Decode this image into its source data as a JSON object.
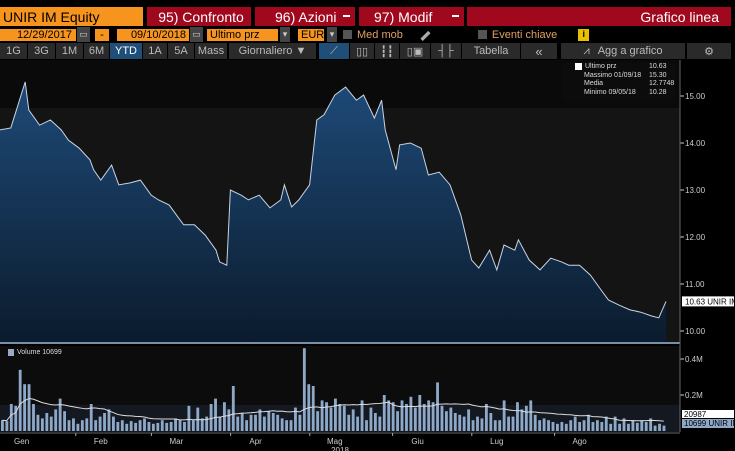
{
  "header": {
    "ticker": "UNIR IM Equity",
    "compare": "95) Confronto",
    "actions": "96) Azioni",
    "edit": "97) Modif",
    "chart_type": "Grafico linea"
  },
  "controls": {
    "start_date": "12/29/2017",
    "dash": "-",
    "end_date": "09/10/2018",
    "field": "Ultimo prz",
    "currency": "EUR",
    "moving_avg": "Med mob",
    "key_events": "Eventi chiave",
    "info": "i"
  },
  "toolbar": {
    "periods": [
      "1G",
      "3G",
      "1M",
      "6M",
      "YTD",
      "1A",
      "5A",
      "Mass"
    ],
    "selected": "YTD",
    "frequency": "Giornaliero ▼",
    "table": "Tabella",
    "collapse": "«",
    "add_chart": "Agg a grafico",
    "settings": "⚙"
  },
  "legend": {
    "last_label": "Ultimo prz",
    "last_value": "10.63",
    "max_label": "Massimo 01/09/18",
    "max_value": "15.30",
    "avg_label": "Media",
    "avg_value": "12.7748",
    "min_label": "Minimo 09/05/18",
    "min_value": "10.28"
  },
  "volume_legend": "Volume 10699",
  "colors": {
    "orange": "#f7941d",
    "red": "#a0081e",
    "line": "#c8d4e4",
    "fill": "#1c3a5e",
    "volume": "#8ea8c8"
  },
  "chart_data": [
    {
      "type": "area",
      "title": "UNIR IM Ultimo prz",
      "ylim": [
        9.7,
        15.75
      ],
      "yticks": [
        "15.00",
        "14.00",
        "13.00",
        "12.00",
        "11.00",
        "10.00"
      ],
      "ytick_values": [
        15,
        14,
        13,
        12,
        11,
        10
      ],
      "last_label": "10.63 UNIR IM",
      "x": [
        0,
        3,
        5,
        7,
        8,
        11,
        14,
        17,
        19,
        22,
        25,
        26,
        28,
        31,
        33,
        36,
        39,
        42,
        44,
        47,
        49,
        51,
        54,
        57,
        60,
        61,
        63,
        64,
        67,
        69,
        72,
        75,
        78,
        79,
        81,
        83,
        86,
        88,
        90,
        93,
        96,
        99,
        101,
        104,
        106,
        107,
        110,
        111,
        114,
        117,
        119,
        122,
        125,
        128,
        131,
        133,
        136,
        138,
        140,
        143,
        144,
        147,
        150,
        153,
        156,
        158,
        161,
        164,
        167,
        169,
        172,
        175,
        178,
        181,
        183,
        185
      ],
      "y": [
        14.28,
        14.32,
        14.81,
        15.3,
        14.7,
        14.38,
        14.49,
        14.28,
        14.06,
        13.89,
        13.64,
        13.43,
        13.21,
        13.53,
        13.11,
        13.15,
        13.21,
        12.89,
        12.79,
        12.68,
        12.47,
        12.26,
        12.26,
        12.04,
        11.72,
        11.47,
        11.4,
        13.0,
        12.89,
        12.79,
        12.89,
        12.62,
        12.79,
        13.11,
        12.64,
        12.79,
        13.11,
        14.49,
        14.6,
        15.02,
        15.19,
        14.91,
        15.02,
        14.53,
        14.91,
        14.28,
        13.43,
        13.96,
        14.0,
        13.89,
        13.32,
        13.38,
        13.11,
        12.47,
        11.51,
        11.34,
        11.72,
        11.3,
        11.83,
        11.72,
        11.94,
        11.51,
        11.3,
        11.55,
        11.47,
        11.4,
        11.4,
        11.19,
        10.87,
        10.66,
        10.55,
        10.45,
        10.4,
        10.32,
        10.28,
        10.63
      ]
    },
    {
      "type": "bar",
      "title": "Volume",
      "ylim": [
        0,
        0.5
      ],
      "yticks": [
        "0.4M",
        "0.2M"
      ],
      "ytick_values": [
        0.4,
        0.2
      ],
      "ma_label": "20987",
      "last_label": "10699 UNIR IM",
      "xlabel": "2018",
      "months": [
        "Gen",
        "Feb",
        "Mar",
        "Apr",
        "Mag",
        "Giu",
        "Lug",
        "Ago"
      ],
      "month_days": [
        6,
        28,
        49,
        71,
        93,
        116,
        138,
        161
      ],
      "values_k": [
        60,
        55,
        150,
        140,
        340,
        260,
        260,
        150,
        90,
        70,
        100,
        80,
        120,
        180,
        110,
        60,
        70,
        40,
        60,
        70,
        150,
        60,
        80,
        100,
        120,
        80,
        50,
        60,
        40,
        55,
        45,
        60,
        70,
        50,
        40,
        45,
        60,
        45,
        50,
        70,
        60,
        50,
        140,
        60,
        130,
        70,
        80,
        150,
        180,
        80,
        160,
        120,
        250,
        80,
        100,
        60,
        90,
        90,
        120,
        80,
        110,
        100,
        90,
        70,
        60,
        60,
        130,
        90,
        460,
        260,
        250,
        110,
        170,
        160,
        130,
        180,
        150,
        140,
        90,
        120,
        80,
        170,
        60,
        130,
        100,
        80,
        200,
        170,
        160,
        110,
        170,
        150,
        190,
        130,
        200,
        150,
        170,
        160,
        270,
        140,
        110,
        130,
        100,
        90,
        80,
        120,
        60,
        80,
        70,
        150,
        100,
        60,
        60,
        170,
        80,
        80,
        160,
        120,
        140,
        170,
        90,
        60,
        70,
        60,
        50,
        40,
        50,
        40,
        60,
        80,
        50,
        60,
        90,
        50,
        60,
        50,
        80,
        40,
        80,
        40,
        70,
        40,
        60,
        45,
        60,
        50,
        70,
        30,
        40,
        30
      ],
      "ma_window": 20
    }
  ]
}
